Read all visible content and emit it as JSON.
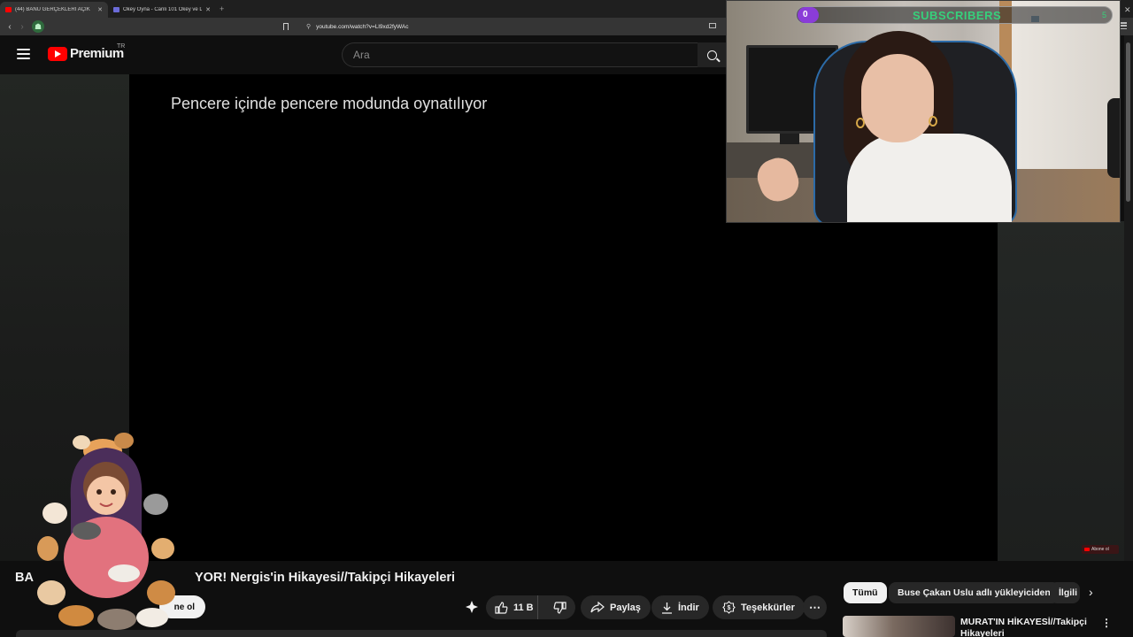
{
  "browser": {
    "tabs": [
      {
        "label": "(44) BANU GERÇEKLERİ AÇIK",
        "active": true
      },
      {
        "label": "Okey Oyna - Canlı 101 Okey ve Düz",
        "active": false
      }
    ],
    "new_tab": "+",
    "url": "youtube.com/watch?v=Ll9xd2fyWAc"
  },
  "youtube": {
    "logo_text": "Premium",
    "region": "TR",
    "search_placeholder": "Ara"
  },
  "player": {
    "pip_message": "Pencere içinde pencere modunda oynatılıyor"
  },
  "webcam": {
    "subscriber_count": "0",
    "subscribers_label": "SUBSCRIBERS",
    "goal": "5"
  },
  "mini_subscribe": "Abone ol",
  "video": {
    "title_start": "BA",
    "title_end": "YOR! Nergis'in Hikayesi//Takipçi Hikayeleri",
    "subscribe_partial": "ne ol"
  },
  "actions": {
    "likes": "11 B",
    "share": "Paylaş",
    "download": "İndir",
    "thanks": "Teşekkürler",
    "more": "⋯"
  },
  "chips": [
    {
      "label": "Tümü",
      "active": true
    },
    {
      "label": "Buse Çakan Uslu adlı yükleyiciden",
      "active": false
    },
    {
      "label": "İlgili",
      "active": false
    }
  ],
  "recommendation": {
    "title": "MURAT'IN HİKAYESİ//Takipçi Hikayeleri"
  },
  "colors": {
    "youtube_red": "#ff0000",
    "subscriber_green": "#36d07b",
    "counter_purple": "#8a3cd8"
  }
}
